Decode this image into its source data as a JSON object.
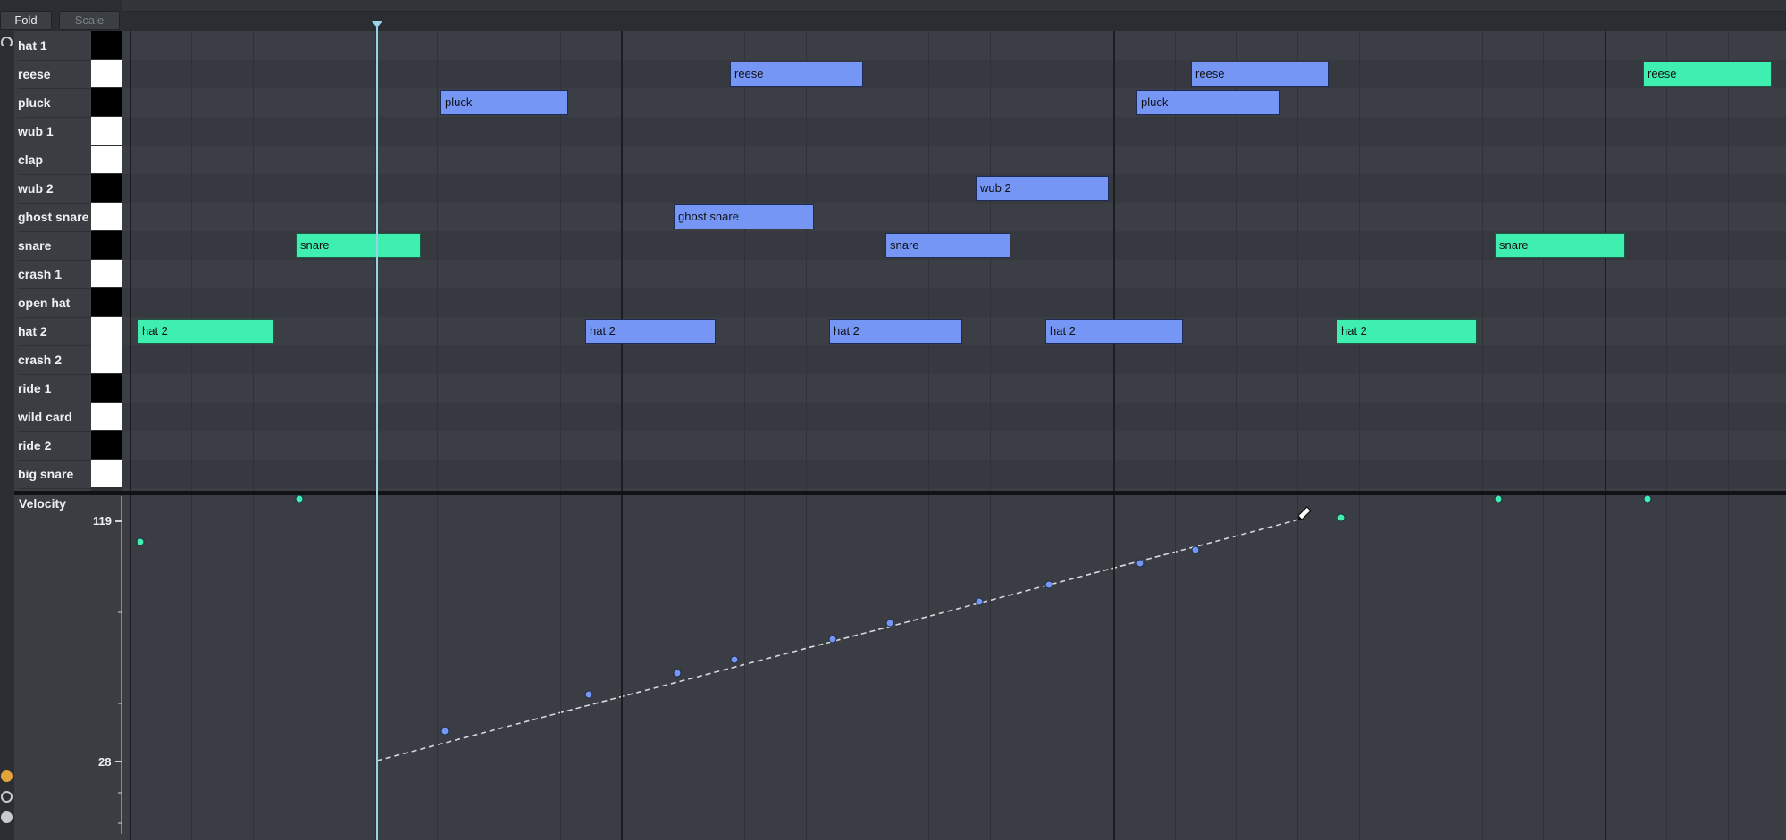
{
  "toolbar": {
    "fold_label": "Fold",
    "scale_label": "Scale"
  },
  "lanes": [
    {
      "name": "hat 1",
      "key": "black"
    },
    {
      "name": "reese",
      "key": "white"
    },
    {
      "name": "pluck",
      "key": "black"
    },
    {
      "name": "wub 1",
      "key": "white"
    },
    {
      "name": "clap",
      "key": "white"
    },
    {
      "name": "wub 2",
      "key": "black"
    },
    {
      "name": "ghost snare",
      "key": "white"
    },
    {
      "name": "snare",
      "key": "black"
    },
    {
      "name": "crash 1",
      "key": "white"
    },
    {
      "name": "open hat",
      "key": "black"
    },
    {
      "name": "hat 2",
      "key": "white"
    },
    {
      "name": "crash 2",
      "key": "white"
    },
    {
      "name": "ride 1",
      "key": "black"
    },
    {
      "name": "wild card",
      "key": "white"
    },
    {
      "name": "ride 2",
      "key": "black"
    },
    {
      "name": "big snare",
      "key": "white"
    }
  ],
  "clips": [
    {
      "label": "hat 2",
      "state": "unselected"
    },
    {
      "label": "snare",
      "state": "unselected"
    },
    {
      "label": "pluck",
      "state": "selected"
    },
    {
      "label": "hat 2",
      "state": "selected"
    },
    {
      "label": "ghost snare",
      "state": "selected"
    },
    {
      "label": "reese",
      "state": "selected"
    },
    {
      "label": "hat 2",
      "state": "selected"
    },
    {
      "label": "snare",
      "state": "selected"
    },
    {
      "label": "wub 2",
      "state": "selected"
    },
    {
      "label": "hat 2",
      "state": "selected"
    },
    {
      "label": "pluck",
      "state": "selected"
    },
    {
      "label": "reese",
      "state": "selected"
    },
    {
      "label": "hat 2",
      "state": "unselected"
    },
    {
      "label": "snare",
      "state": "unselected"
    },
    {
      "label": "reese",
      "state": "unselected"
    }
  ],
  "velocity": {
    "title": "Velocity",
    "tick_high": "119",
    "tick_low": "28"
  },
  "colors": {
    "selected_clip": "#7596f5",
    "unselected_clip": "#3fefb0",
    "playhead": "#9ad3e8"
  },
  "icons": [
    "headphones-icon",
    "record-icon",
    "back-icon",
    "play-icon",
    "pencil-icon"
  ]
}
